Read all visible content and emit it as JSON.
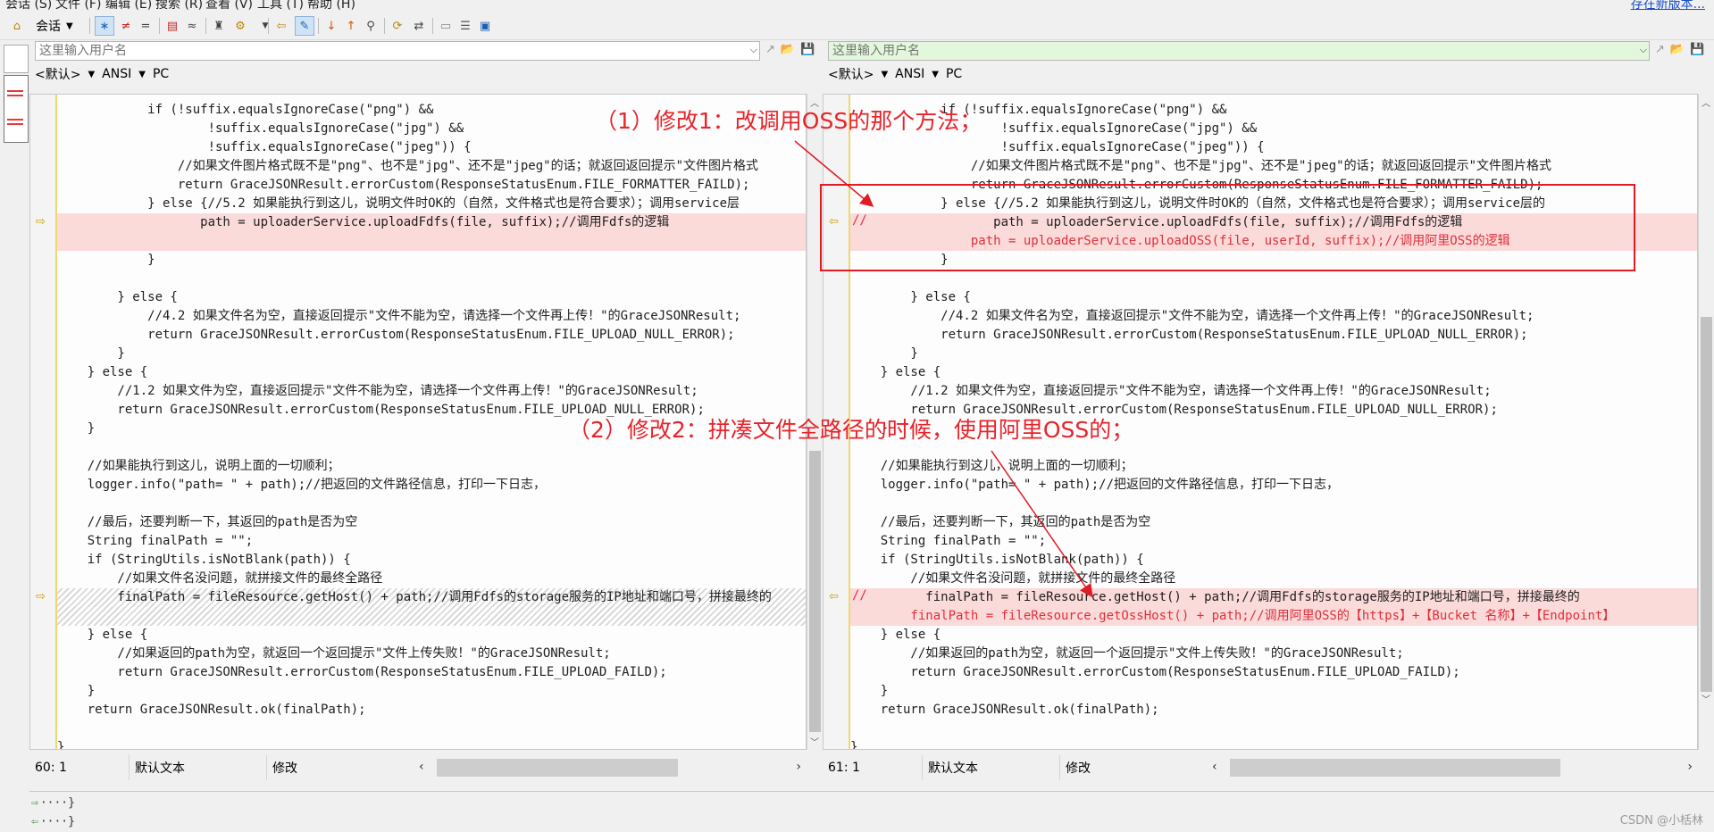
{
  "menu": {
    "items": [
      "会话 (S)",
      "文件 (F)",
      "编辑 (E)",
      "搜索 (R)",
      "查看 (V)",
      "工具 (T)",
      "帮助 (H)"
    ],
    "update_link": "存在新版本..."
  },
  "toolbar": {
    "session_label": "会话"
  },
  "left": {
    "path_placeholder": "这里输入用户名",
    "encoding": [
      "<默认>",
      "ANSI",
      "PC"
    ],
    "status": {
      "position": "60: 1",
      "mode": "默认文本",
      "state": "修改"
    }
  },
  "right": {
    "path_placeholder": "这里输入用户名",
    "encoding": [
      "<默认>",
      "ANSI",
      "PC"
    ],
    "status": {
      "position": "61: 1",
      "mode": "默认文本",
      "state": "修改"
    }
  },
  "left_lines": [
    "            if (!suffix.equalsIgnoreCase(\"png\") &&",
    "                    !suffix.equalsIgnoreCase(\"jpg\") &&",
    "                    !suffix.equalsIgnoreCase(\"jpeg\")) {",
    "                //如果文件图片格式既不是\"png\"、也不是\"jpg\"、还不是\"jpeg\"的话；就返回返回提示\"文件图片格式",
    "                return GraceJSONResult.errorCustom(ResponseStatusEnum.FILE_FORMATTER_FAILD);",
    "            } else {//5.2 如果能执行到这儿，说明文件时OK的（自然，文件格式也是符合要求）；调用service层",
    "                   path = uploaderService.uploadFdfs(file, suffix);//调用Fdfs的逻辑",
    "",
    "            }",
    "",
    "        } else {",
    "            //4.2 如果文件名为空，直接返回提示\"文件不能为空，请选择一个文件再上传！\"的GraceJSONResult;",
    "            return GraceJSONResult.errorCustom(ResponseStatusEnum.FILE_UPLOAD_NULL_ERROR);",
    "        }",
    "    } else {",
    "        //1.2 如果文件为空，直接返回提示\"文件不能为空，请选择一个文件再上传！\"的GraceJSONResult;",
    "        return GraceJSONResult.errorCustom(ResponseStatusEnum.FILE_UPLOAD_NULL_ERROR);",
    "    }",
    "",
    "    //如果能执行到这儿，说明上面的一切顺利；",
    "    logger.info(\"path= \" + path);//把返回的文件路径信息，打印一下日志，",
    "",
    "    //最后，还要判断一下，其返回的path是否为空",
    "    String finalPath = \"\";",
    "    if (StringUtils.isNotBlank(path)) {",
    "        //如果文件名没问题，就拼接文件的最终全路径",
    "        finalPath = fileResource.getHost() + path;//调用Fdfs的storage服务的IP地址和端口号，拼接最终的",
    "",
    "    } else {",
    "        //如果返回的path为空，就返回一个返回提示\"文件上传失败！\"的GraceJSONResult;",
    "        return GraceJSONResult.errorCustom(ResponseStatusEnum.FILE_UPLOAD_FAILD);",
    "    }",
    "    return GraceJSONResult.ok(finalPath);",
    "",
    "}"
  ],
  "right_lines": [
    "            if (!suffix.equalsIgnoreCase(\"png\") &&",
    "                    !suffix.equalsIgnoreCase(\"jpg\") &&",
    "                    !suffix.equalsIgnoreCase(\"jpeg\")) {",
    "                //如果文件图片格式既不是\"png\"、也不是\"jpg\"、还不是\"jpeg\"的话；就返回返回提示\"文件图片格式",
    "                return GraceJSONResult.errorCustom(ResponseStatusEnum.FILE_FORMATTER_FAILD);",
    "            } else {//5.2 如果能执行到这儿，说明文件时OK的（自然，文件格式也是符合要求）；调用service层的",
    "                   path = uploaderService.uploadFdfs(file, suffix);//调用Fdfs的逻辑",
    "                path = uploaderService.uploadOSS(file, userId, suffix);//调用阿里OSS的逻辑",
    "            }",
    "",
    "        } else {",
    "            //4.2 如果文件名为空，直接返回提示\"文件不能为空，请选择一个文件再上传！\"的GraceJSONResult;",
    "            return GraceJSONResult.errorCustom(ResponseStatusEnum.FILE_UPLOAD_NULL_ERROR);",
    "        }",
    "    } else {",
    "        //1.2 如果文件为空，直接返回提示\"文件不能为空，请选择一个文件再上传！\"的GraceJSONResult;",
    "        return GraceJSONResult.errorCustom(ResponseStatusEnum.FILE_UPLOAD_NULL_ERROR);",
    "    }",
    "",
    "    //如果能执行到这儿，说明上面的一切顺利；",
    "    logger.info(\"path= \" + path);//把返回的文件路径信息，打印一下日志，",
    "",
    "    //最后，还要判断一下，其返回的path是否为空",
    "    String finalPath = \"\";",
    "    if (StringUtils.isNotBlank(path)) {",
    "        //如果文件名没问题，就拼接文件的最终全路径",
    "          finalPath = fileResource.getHost() + path;//调用Fdfs的storage服务的IP地址和端口号，拼接最终的",
    "        finalPath = fileResource.getOssHost() + path;//调用阿里OSS的【https】+【Bucket 名称】+【Endpoint】",
    "    } else {",
    "        //如果返回的path为空，就返回一个返回提示\"文件上传失败！\"的GraceJSONResult;",
    "        return GraceJSONResult.errorCustom(ResponseStatusEnum.FILE_UPLOAD_FAILD);",
    "    }",
    "    return GraceJSONResult.ok(finalPath);",
    "",
    "}"
  ],
  "diff_marks": {
    "comment_prefix": "//"
  },
  "annotations": {
    "note1": "（1）修改1：改调用OSS的那个方法；",
    "note2": "（2）修改2：拼凑文件全路径的时候，使用阿里OSS的；"
  },
  "bottom": {
    "line1": "····}",
    "line2": "····}"
  },
  "watermark": "CSDN @小栝林",
  "colors": {
    "diff_bg": "#fbdada",
    "inserted_text": "#e0303a",
    "annotation": "#e8232a",
    "marker": "#f0d870"
  }
}
